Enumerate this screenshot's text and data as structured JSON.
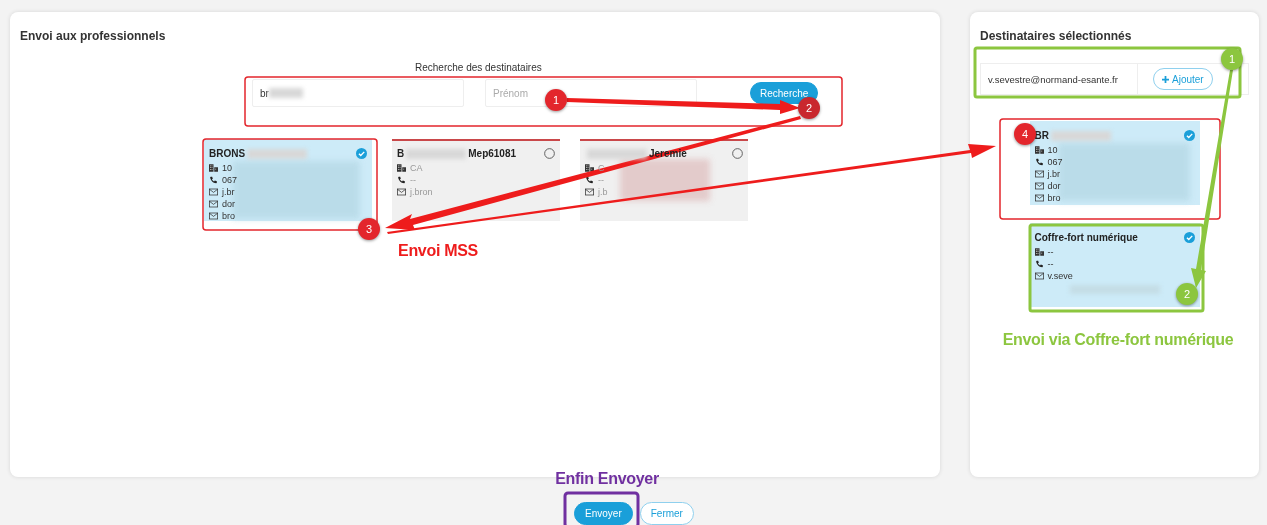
{
  "left_panel": {
    "title": "Envoi aux professionnels",
    "search": {
      "label": "Recherche des destinataires",
      "name_value": "br",
      "first_name_placeholder": "Prénom",
      "button": "Recherche"
    },
    "results": [
      {
        "selected": true,
        "blurred": true,
        "name": [
          {
            "kind": "text",
            "text": "BRONS"
          },
          {
            "kind": "blur"
          }
        ],
        "lines": [
          {
            "kind": "address",
            "text": "10"
          },
          {
            "kind": "phone",
            "text": "067"
          },
          {
            "kind": "email",
            "text": "j.br"
          },
          {
            "kind": "email",
            "text": "dor"
          },
          {
            "kind": "email",
            "text": "bro"
          }
        ]
      },
      {
        "selected": false,
        "blurred": false,
        "name": [
          {
            "kind": "text",
            "text": "B"
          },
          {
            "kind": "blur"
          },
          {
            "kind": "text",
            "text": "Mep61081"
          }
        ],
        "lines": [
          {
            "kind": "address",
            "text": "CA"
          },
          {
            "kind": "phone",
            "text": "--"
          },
          {
            "kind": "email",
            "text": "j.bron"
          }
        ]
      },
      {
        "selected": false,
        "blurred": true,
        "name": [
          {
            "kind": "blur"
          },
          {
            "kind": "text",
            "text": "Jeremie"
          }
        ],
        "lines": [
          {
            "kind": "address",
            "text": "C"
          },
          {
            "kind": "phone",
            "text": "--"
          },
          {
            "kind": "email",
            "text": "j.b"
          }
        ]
      }
    ]
  },
  "right_panel": {
    "title": "Destinataires sélectionnés",
    "email_value": "v.sevestre@normand-esante.fr",
    "add_button": "Ajouter",
    "recipients": [
      {
        "selected": true,
        "blurred": true,
        "name": [
          {
            "kind": "text",
            "text": "BR"
          },
          {
            "kind": "blur"
          }
        ],
        "lines": [
          {
            "kind": "address",
            "text": "10"
          },
          {
            "kind": "phone",
            "text": "067"
          },
          {
            "kind": "email",
            "text": "j.br"
          },
          {
            "kind": "email",
            "text": "dor"
          },
          {
            "kind": "email",
            "text": "bro"
          }
        ]
      },
      {
        "selected": true,
        "blurred": false,
        "name": [
          {
            "kind": "text",
            "text": "Coffre-fort numérique"
          }
        ],
        "lines": [
          {
            "kind": "address",
            "text": "--"
          },
          {
            "kind": "phone",
            "text": "--"
          },
          {
            "kind": "email",
            "text": "v.seve"
          }
        ]
      }
    ]
  },
  "buttons": [
    {
      "kind": "primary",
      "label": "Envoyer"
    },
    {
      "kind": "outline",
      "label": "Fermer"
    }
  ],
  "annotations": [
    {
      "kind": "step",
      "text": "1",
      "color": "#e3262c"
    },
    {
      "kind": "step",
      "text": "2",
      "color": "#c9282e"
    },
    {
      "kind": "step",
      "text": "3",
      "color": "#e3262c"
    },
    {
      "kind": "step",
      "text": "4",
      "color": "#e3262c"
    },
    {
      "kind": "step",
      "text": "1",
      "color": "#8cc63f"
    },
    {
      "kind": "step",
      "text": "2",
      "color": "#8cc63f"
    },
    {
      "kind": "caption",
      "text": "Envoi MSS",
      "color": "#ee1c1c"
    },
    {
      "kind": "caption",
      "text": "Envoi via Coffre-fort numérique",
      "color": "#8cc63f"
    },
    {
      "kind": "caption",
      "text": "Enfin Envoyer",
      "color": "#7030a0"
    }
  ]
}
